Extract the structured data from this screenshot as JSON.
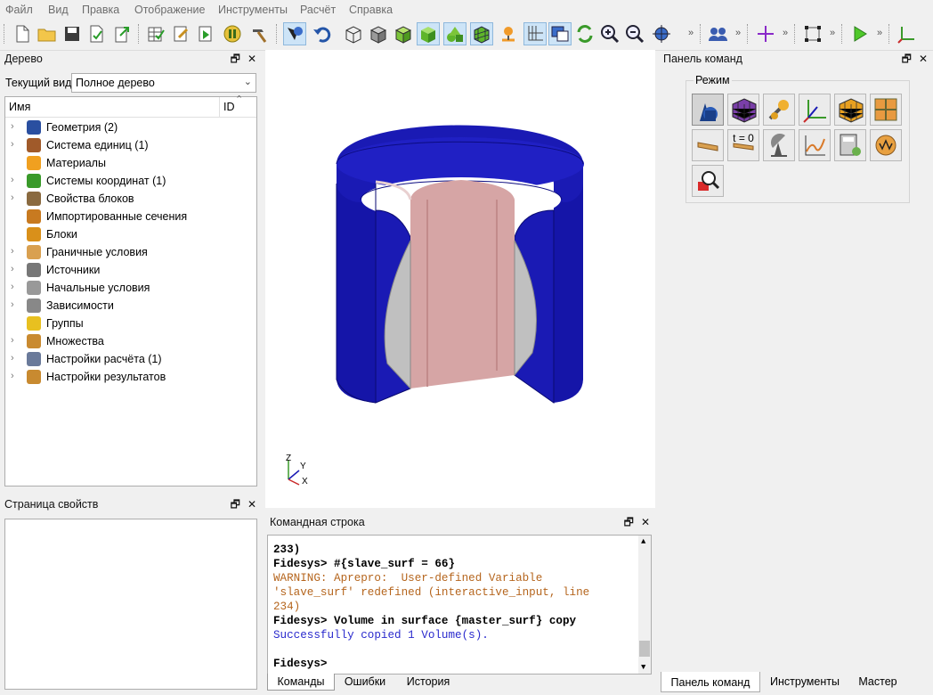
{
  "menu": [
    "Файл",
    "Вид",
    "Правка",
    "Отображение",
    "Инструменты",
    "Расчёт",
    "Справка"
  ],
  "toolbar": {
    "buttons": [
      "new-file-icon",
      "open-folder-icon",
      "save-icon",
      "save-as-icon",
      "export-icon",
      "table-check-icon",
      "journal-edit-icon",
      "play-script-icon",
      "pause-icon",
      "hammer-icon",
      "pick-mode-icon",
      "undo-icon",
      "wireframe-cube-icon",
      "hidden-line-cube-icon",
      "smooth-shade-cube-icon",
      "shaded-cube-icon",
      "geometry-shapes-icon",
      "mesh-cube-icon",
      "pin-icon",
      "axes-grid-icon",
      "windows-icon",
      "refresh-icon",
      "zoom-in-icon",
      "zoom-out-icon",
      "fit-view-icon",
      "users-icon",
      "crosshair-icon",
      "bounding-box-icon",
      "run-icon",
      "axes-icon"
    ],
    "overflow": "»"
  },
  "tree_panel": {
    "title": "Дерево",
    "view_label": "Текущий вид",
    "view_value": "Полное дерево",
    "col_name": "Имя",
    "col_id": "ID",
    "items": [
      {
        "label": "Геометрия (2)",
        "icon": "geometry-icon",
        "expandable": true
      },
      {
        "label": "Система единиц (1)",
        "icon": "units-icon",
        "expandable": true
      },
      {
        "label": "Материалы",
        "icon": "materials-icon",
        "expandable": false
      },
      {
        "label": "Системы координат (1)",
        "icon": "coordinate-system-icon",
        "expandable": true
      },
      {
        "label": "Свойства блоков",
        "icon": "block-properties-icon",
        "expandable": true
      },
      {
        "label": "Импортированные сечения",
        "icon": "imported-sections-icon",
        "expandable": false
      },
      {
        "label": "Блоки",
        "icon": "blocks-icon",
        "expandable": false
      },
      {
        "label": "Граничные условия",
        "icon": "boundary-conditions-icon",
        "expandable": true
      },
      {
        "label": "Источники",
        "icon": "sources-icon",
        "expandable": true
      },
      {
        "label": "Начальные условия",
        "icon": "initial-conditions-icon",
        "expandable": true
      },
      {
        "label": "Зависимости",
        "icon": "dependencies-icon",
        "expandable": true
      },
      {
        "label": "Группы",
        "icon": "groups-icon",
        "expandable": false
      },
      {
        "label": "Множества",
        "icon": "sets-icon",
        "expandable": true
      },
      {
        "label": "Настройки расчёта (1)",
        "icon": "analysis-settings-icon",
        "expandable": true
      },
      {
        "label": "Настройки результатов",
        "icon": "results-settings-icon",
        "expandable": true
      }
    ]
  },
  "properties_panel": {
    "title": "Страница свойств"
  },
  "viewport": {
    "axis_z": "Z",
    "axis_y": "Y",
    "axis_x": "X"
  },
  "console": {
    "title": "Командная строка",
    "lines": [
      {
        "text": "233)",
        "style": "bold"
      },
      {
        "text": "Fidesys> #{slave_surf = 66}",
        "style": "bold"
      },
      {
        "text": "WARNING: Aprepro:  User-defined Variable",
        "style": "warn"
      },
      {
        "text": "'slave_surf' redefined (interactive_input, line",
        "style": "warn"
      },
      {
        "text": "234)",
        "style": "warn"
      },
      {
        "text": "Fidesys> Volume in surface {master_surf} copy",
        "style": "bold"
      },
      {
        "text": "Successfully copied 1 Volume(s).",
        "style": "ok"
      },
      {
        "text": "",
        "style": "bold"
      },
      {
        "text": "Fidesys>",
        "style": "bold"
      }
    ],
    "tabs": [
      "Команды",
      "Ошибки",
      "История"
    ]
  },
  "command_panel": {
    "title": "Панель команд",
    "mode_label": "Режим",
    "t0_label": "t = 0",
    "buttons": [
      "geometry-mode-icon",
      "mesh-mode-icon",
      "materials-mode-icon",
      "coordinates-mode-icon",
      "blocks-mode-icon",
      "sets-mode-icon",
      "boundary-mode-icon",
      "initial-conditions-mode-icon",
      "sources-mode-icon",
      "dependencies-mode-icon",
      "analysis-mode-icon",
      "results-mode-icon",
      "inspect-mode-icon"
    ]
  },
  "bottom_tabs": [
    "Панель команд",
    "Инструменты",
    "Мастер"
  ],
  "colors": {
    "model_blue": "#1a1ab4",
    "inner_pink": "#d6a5a5",
    "inner_gray": "#c0c0c0"
  }
}
